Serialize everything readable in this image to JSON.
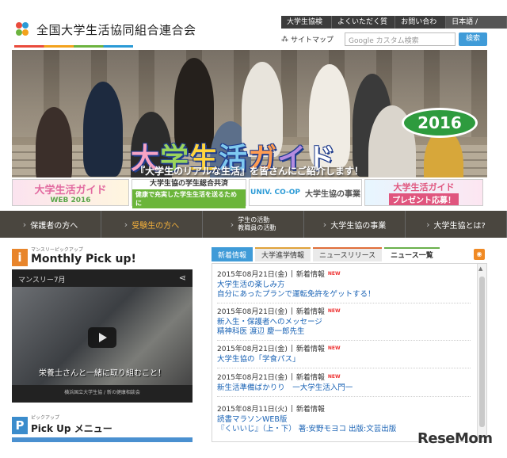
{
  "header": {
    "org_name": "全国大学生活協同組合連合会",
    "topnav": [
      "大学生協検索",
      "よくいただく質問",
      "お問い合わせ"
    ],
    "lang": "日本語 / English",
    "sitemap": "サイトマップ",
    "search_placeholder": "Google カスタム検索",
    "search_button": "検索"
  },
  "hero": {
    "title_chars": [
      "大",
      "学",
      "生",
      "活",
      "ガ",
      "イ",
      "ド"
    ],
    "year": "2016",
    "subtitle": "『大学生のリアルな生活』を皆さんにご紹介します！"
  },
  "banners": {
    "b1_title": "大学生活ガイド",
    "b1_sub": "WEB 2016",
    "b2_title": "大学生協の学生総合共済",
    "b2_tag": "健康で充実した学生生活を送るために",
    "b3_logo": "UNIV. CO-OP",
    "b3_text": "大学生協の事業",
    "b4_title": "大学生活ガイド",
    "b4_sub": "プレゼント応募！"
  },
  "nav": [
    {
      "label": "保護者の方へ",
      "active": false
    },
    {
      "label": "受験生の方へ",
      "active": true
    },
    {
      "label": "学生の活動\n教職員の活動",
      "active": false
    },
    {
      "label": "大学生協の事業",
      "active": false
    },
    {
      "label": "大学生協とは?",
      "active": false
    }
  ],
  "monthly": {
    "kana": "マンスリーピックアップ",
    "title": "Monthly Pick up!",
    "badge": "i"
  },
  "video": {
    "title": "マンスリー7月",
    "caption": "栄養士さんと一緒に取り組むこと！",
    "sub": "横浜国立大学生協 / 新の健康相談会"
  },
  "pickup": {
    "kana": "ピックアップ",
    "title": "Pick Up メニュー",
    "badge": "P"
  },
  "tabs": [
    "新着情報",
    "大学進学情報",
    "ニュースリリース",
    "ニュース一覧"
  ],
  "news": [
    {
      "date": "2015年08月21日(金)",
      "cat": "新着情報",
      "lines": [
        "大学生活の楽しみ方",
        "自分にあったプランで運転免許をゲットする！"
      ]
    },
    {
      "date": "2015年08月21日(金)",
      "cat": "新着情報",
      "lines": [
        "新入生・保護者へのメッセージ",
        "精神科医 渡辺 慶一郎先生"
      ]
    },
    {
      "date": "2015年08月21日(金)",
      "cat": "新着情報",
      "lines": [
        "大学生協の「学食パス」"
      ]
    },
    {
      "date": "2015年08月21日(金)",
      "cat": "新着情報",
      "lines": [
        "新生活準備ばかりり　一大学生活入門一"
      ]
    },
    {
      "date": "2015年08月11日(火)",
      "cat": "新着情報",
      "lines": [
        "読書マラソンWEB版",
        "『くいいじ』（上・下） 著:安野モヨコ 出版:文芸出版"
      ]
    }
  ],
  "new_label": "NEW",
  "watermark": "ReseMom"
}
